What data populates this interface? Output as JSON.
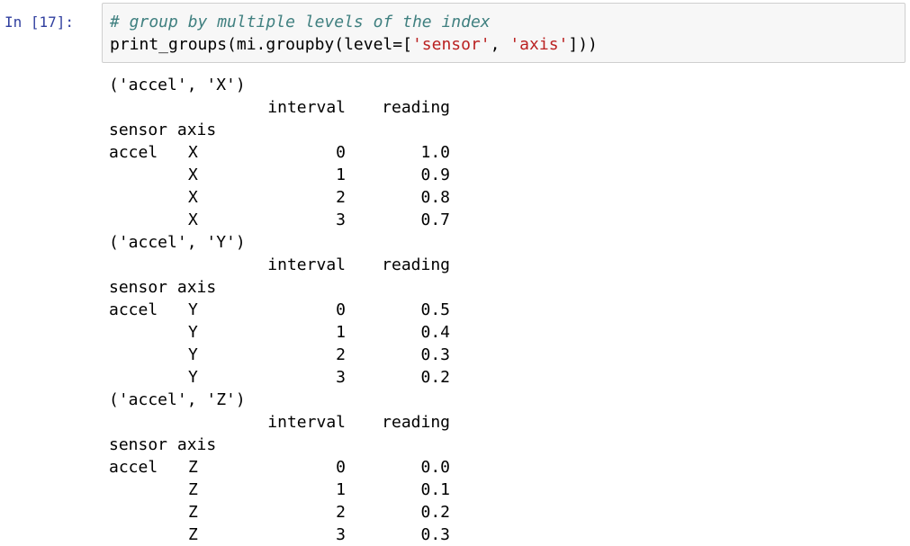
{
  "cell": {
    "prompt": "In [17]:",
    "code": {
      "comment": "# group by multiple levels of the index",
      "line2_prefix": "print_groups(mi.groupby(level=[",
      "str1": "'sensor'",
      "sep": ", ",
      "str2": "'axis'",
      "line2_suffix": "]))"
    }
  },
  "output": {
    "column_headers": {
      "interval": "interval",
      "reading": "reading"
    },
    "index_names": "sensor axis",
    "groups": [
      {
        "title": "('accel', 'X')",
        "rows": [
          {
            "sensor": "accel",
            "axis": "X",
            "interval": "0",
            "reading": "1.0"
          },
          {
            "sensor": "",
            "axis": "X",
            "interval": "1",
            "reading": "0.9"
          },
          {
            "sensor": "",
            "axis": "X",
            "interval": "2",
            "reading": "0.8"
          },
          {
            "sensor": "",
            "axis": "X",
            "interval": "3",
            "reading": "0.7"
          }
        ]
      },
      {
        "title": "('accel', 'Y')",
        "rows": [
          {
            "sensor": "accel",
            "axis": "Y",
            "interval": "0",
            "reading": "0.5"
          },
          {
            "sensor": "",
            "axis": "Y",
            "interval": "1",
            "reading": "0.4"
          },
          {
            "sensor": "",
            "axis": "Y",
            "interval": "2",
            "reading": "0.3"
          },
          {
            "sensor": "",
            "axis": "Y",
            "interval": "3",
            "reading": "0.2"
          }
        ]
      },
      {
        "title": "('accel', 'Z')",
        "rows": [
          {
            "sensor": "accel",
            "axis": "Z",
            "interval": "0",
            "reading": "0.0"
          },
          {
            "sensor": "",
            "axis": "Z",
            "interval": "1",
            "reading": "0.1"
          },
          {
            "sensor": "",
            "axis": "Z",
            "interval": "2",
            "reading": "0.2"
          },
          {
            "sensor": "",
            "axis": "Z",
            "interval": "3",
            "reading": "0.3"
          }
        ]
      }
    ]
  },
  "colors": {
    "prompt": "#303f9f",
    "comment": "#408080",
    "string": "#ba2121",
    "input_bg": "#f7f7f7",
    "input_border": "#cfcfcf"
  }
}
